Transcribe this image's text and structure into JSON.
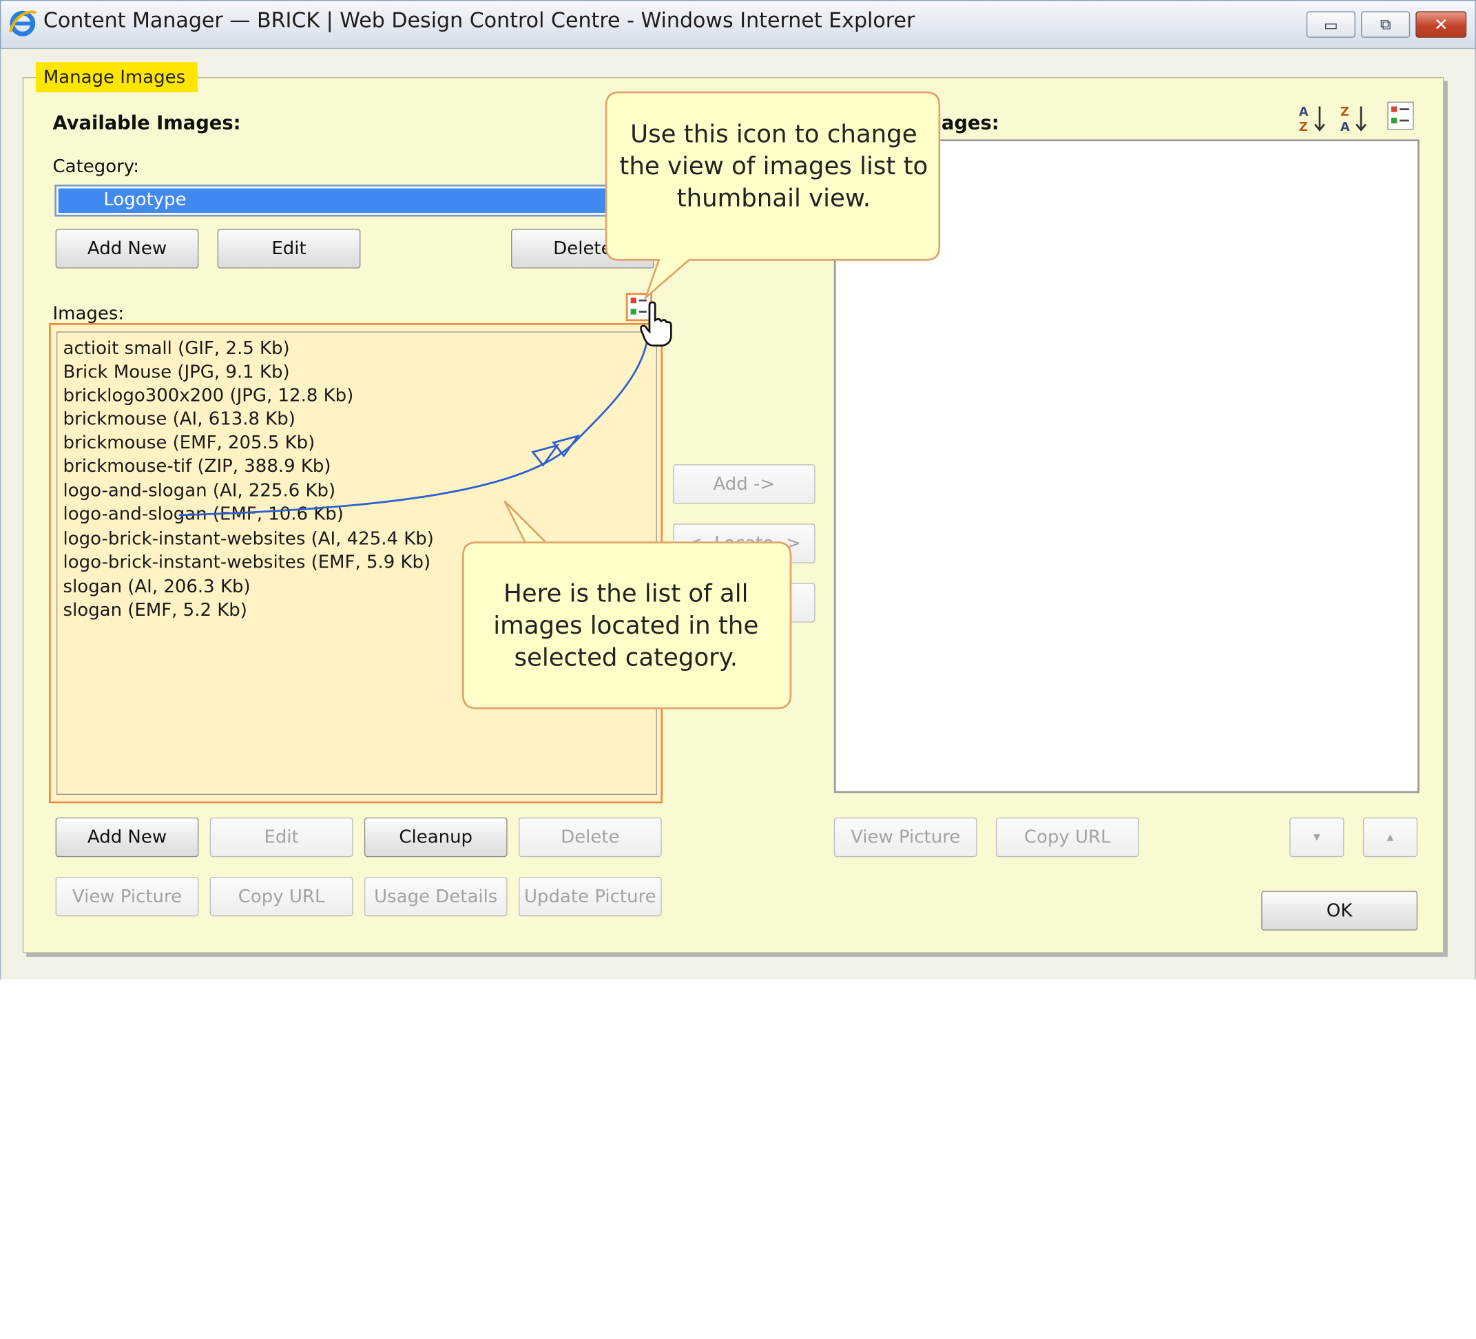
{
  "window": {
    "title": "Content Manager — BRICK | Web Design Control Centre - Windows Internet Explorer",
    "minimize": "▭",
    "restore": "⧉",
    "close": "✕"
  },
  "tab": {
    "label": "Manage Images"
  },
  "available": {
    "heading": "Available Images:",
    "category_label": "Category:",
    "category_value": "Logotype",
    "buttons": {
      "add_new": "Add New",
      "edit": "Edit",
      "delete": "Delete"
    },
    "images_label": "Images:",
    "images": [
      "actioit small  (GIF, 2.5 Kb)",
      "Brick Mouse  (JPG, 9.1 Kb)",
      "bricklogo300x200  (JPG, 12.8 Kb)",
      "brickmouse  (AI, 613.8 Kb)",
      "brickmouse  (EMF, 205.5 Kb)",
      "brickmouse-tif  (ZIP, 388.9 Kb)",
      "logo-and-slogan  (AI, 225.6 Kb)",
      "logo-and-slogan  (EMF, 10.6 Kb)",
      "logo-brick-instant-websites  (AI, 425.4 Kb)",
      "logo-brick-instant-websites  (EMF, 5.9 Kb)",
      "slogan  (AI, 206.3 Kb)",
      "slogan  (EMF, 5.2 Kb)"
    ],
    "bottom_buttons": {
      "add_new": "Add New",
      "edit": "Edit",
      "cleanup": "Cleanup",
      "delete": "Delete",
      "view_picture": "View Picture",
      "copy_url": "Copy URL",
      "usage_details": "Usage Details",
      "update_picture": "Update Picture"
    }
  },
  "middle": {
    "add": "Add ->",
    "remove": "<- Locate ->"
  },
  "selected": {
    "heading_visible": "nages:",
    "view_picture": "View Picture",
    "copy_url": "Copy URL",
    "move_down": "▾",
    "move_up": "▴",
    "ok": "OK"
  },
  "callouts": {
    "view_toggle": "Use this icon to change the view of images list to thumbnail view.",
    "images_list": "Here is the list of all images located in the selected category."
  },
  "icons": {
    "browser": "ie-icon",
    "sort_asc": "sort-az-icon",
    "sort_desc": "sort-za-icon",
    "view_toggle": "thumbnail-view-icon",
    "pointer": "hand-cursor-icon"
  },
  "colors": {
    "tab_highlight": "#ffe600",
    "selection": "#3f89f0",
    "list_border": "#f08d3c",
    "callout_bg": "#ffffc9",
    "panel_bg": "#fafad2"
  }
}
